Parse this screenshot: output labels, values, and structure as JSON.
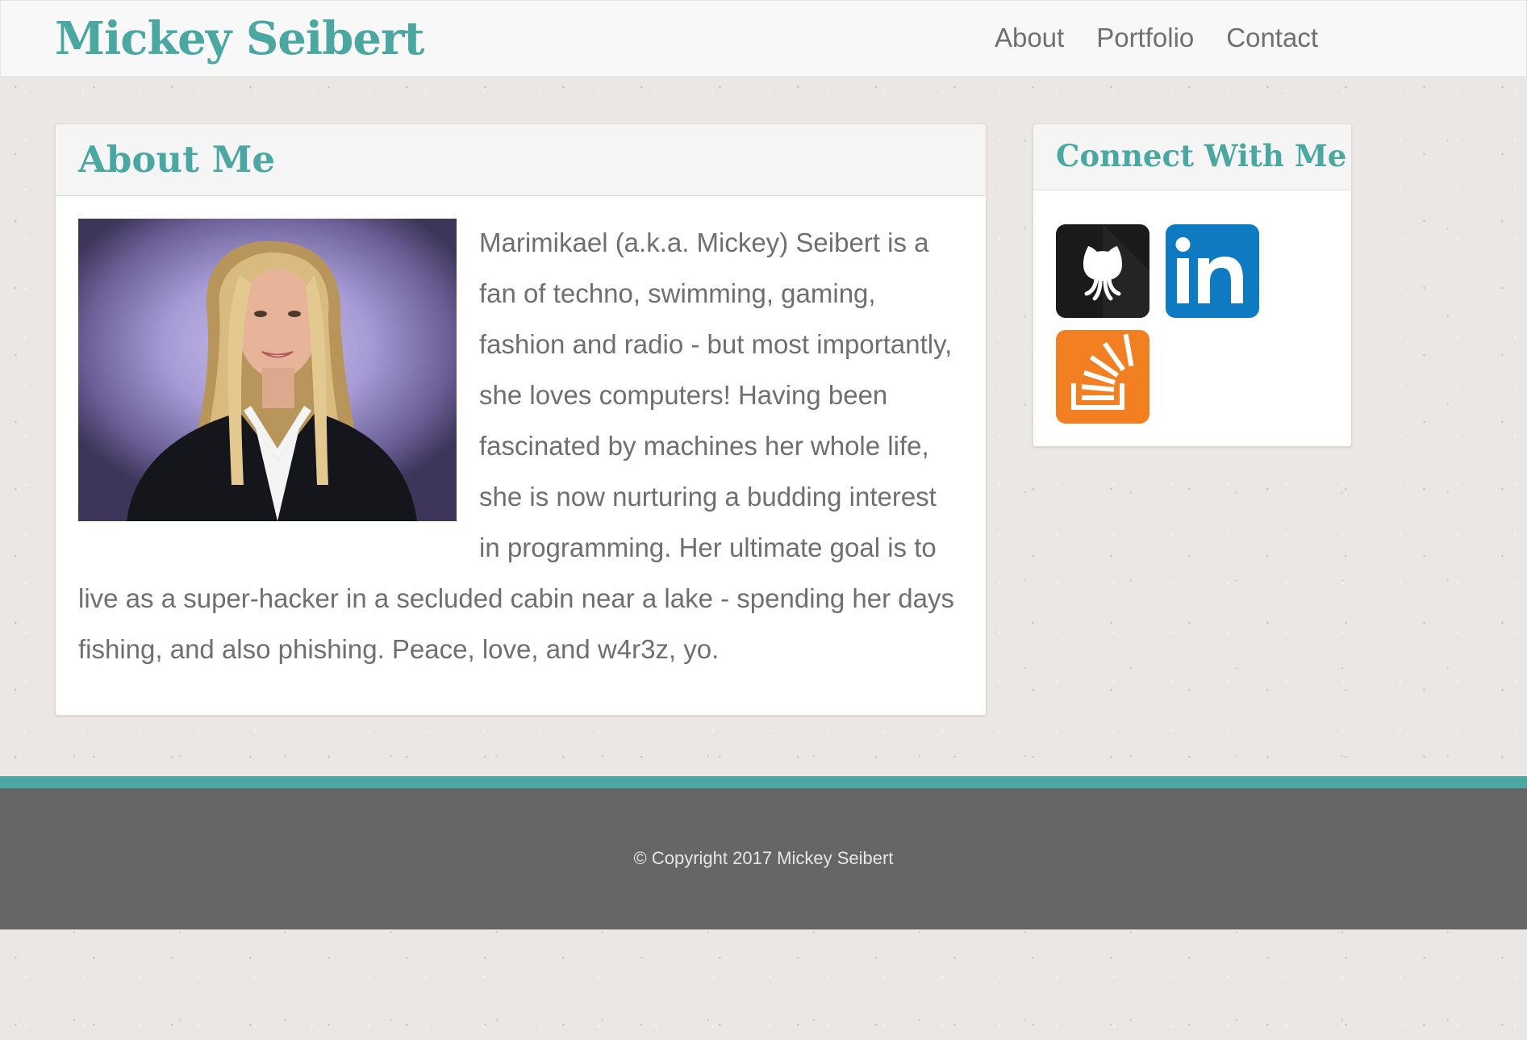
{
  "header": {
    "brand": "Mickey Seibert",
    "nav": [
      "About",
      "Portfolio",
      "Contact"
    ]
  },
  "about": {
    "title": "About Me",
    "text": "Marimikael (a.k.a. Mickey) Seibert is a fan of techno, swimming, gaming, fashion and radio - but most importantly, she loves computers! Having been fascinated by machines her whole life, she is now nurturing a budding interest in programming. Her ultimate goal is to live as a super-hacker in a secluded cabin near a lake - spending her days fishing, and also phishing. Peace, love, and w4r3z, yo."
  },
  "connect": {
    "title": "Connect With Me",
    "links": [
      {
        "icon": "github-icon",
        "color": "#1a1a1a"
      },
      {
        "icon": "linkedin-icon",
        "color": "#0e7ac1"
      },
      {
        "icon": "stackoverflow-icon",
        "color": "#f27f21"
      }
    ]
  },
  "footer": {
    "copyright": "© Copyright 2017 Mickey Seibert"
  },
  "colors": {
    "accent": "#4aa7a1",
    "footer": "#666666",
    "text": "#6f6f6f"
  }
}
